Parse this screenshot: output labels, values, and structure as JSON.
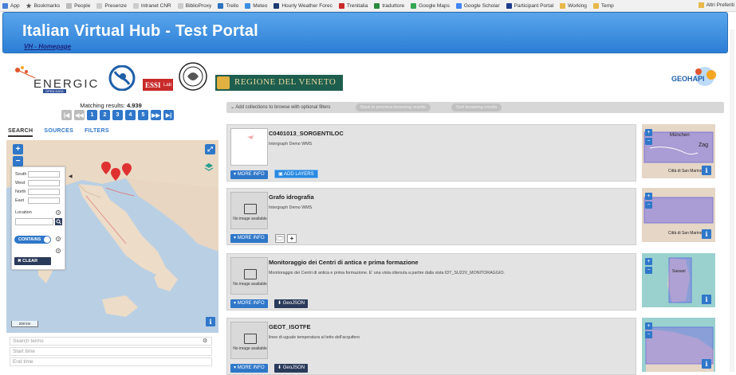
{
  "bookmarks": {
    "items": [
      "App",
      "Bookmarks",
      "People",
      "Presenze",
      "Intranet CNR",
      "BiblioProxy",
      "Trello",
      "Meteo",
      "Hourly Weather Forec",
      "Trenitalia",
      "traduttore",
      "Google Maps",
      "Google Scholar",
      "Participant Portal",
      "Working",
      "Temp"
    ],
    "right": "Altri Preferiti"
  },
  "header": {
    "title": "Italian Virtual Hub - Test Portal",
    "homepage_link": "VH - Homepage"
  },
  "logos": {
    "energic": "ENERGIC",
    "energic_sub": "OPEN DATA",
    "essi": "ESSI",
    "essi_sub": "Lab",
    "regione": "REGIONE DEL VENETO",
    "geohapi": "GEOHAPI"
  },
  "results": {
    "label": "Matching results:",
    "count": "4.939"
  },
  "pager": [
    "1",
    "2",
    "3",
    "4",
    "5"
  ],
  "tabs": {
    "search": "SEARCH",
    "sources": "SOURCES",
    "filters": "FILTERS"
  },
  "map": {
    "scale": "200 km"
  },
  "filters": {
    "south": "South",
    "west": "West",
    "north": "North",
    "east": "East",
    "location": "Location",
    "contains": "CONTAINS",
    "clear": "CLEAR"
  },
  "search": {
    "terms_placeholder": "Search terms",
    "start_placeholder": "Start time",
    "end_placeholder": "End time"
  },
  "toolbar": {
    "add_collections": "Add collections to browse with optional filters",
    "btn1": "Back to previous browsing results",
    "btn2": "Sort browsing results"
  },
  "results_list": [
    {
      "title": "C0401013_SORGENTILOC",
      "desc": "Intergraph Demo WMS",
      "more": "MORE INFO",
      "action": "ADD LAYERS"
    },
    {
      "title": "Grafo idrografia",
      "desc": "Intergraph Demo WMS",
      "more": "MORE INFO",
      "action": ""
    },
    {
      "title": "Monitoraggio dei Centri di antica e prima formazione",
      "desc": "Monitoraggio dei Centri di antica e prima formazione. E' una vista ottenuta a partire dalla vista IDT_SU22V_MONITORAGGIO.",
      "more": "MORE INFO",
      "action": "GeoJSON"
    },
    {
      "title": "GEOT_ISOTFE",
      "desc": "linee di uguale temperatura al tetto dell'acquifero",
      "more": "MORE INFO",
      "action": "GeoJSON"
    }
  ],
  "no_image": "No image available",
  "mini_maps": {
    "label1": "München",
    "label2": "Zag",
    "label3": "Città di San Marino",
    "label4": "Sassari"
  }
}
